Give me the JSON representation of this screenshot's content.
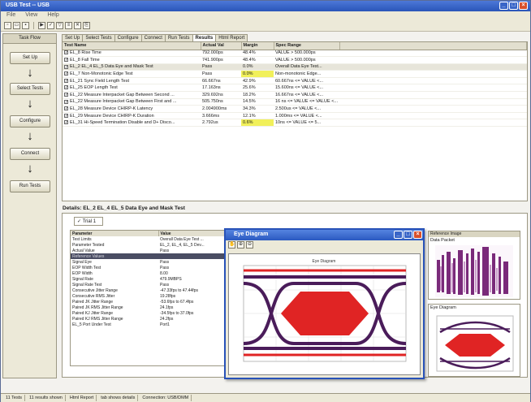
{
  "window": {
    "title": "USB Test -- USB",
    "minimize": "_",
    "maximize": "□",
    "close": "×"
  },
  "menu": [
    "File",
    "View",
    "Help"
  ],
  "taskflow": {
    "header": "Task Flow",
    "steps": [
      "Set Up",
      "Select Tests",
      "Configure",
      "Connect",
      "Run Tests"
    ]
  },
  "tabs": [
    "Set Up",
    "Select Tests",
    "Configure",
    "Connect",
    "Run Tests",
    "Results",
    "Html Report"
  ],
  "results": {
    "columns": [
      "Test Name",
      "Actual Val",
      "Margin",
      "Spec Range"
    ],
    "rows": [
      {
        "name": "EL_8 Rise Time",
        "actual": "792.000ps",
        "margin": "48.4%",
        "spec": "VALUE > 500.000ps",
        "hl": false
      },
      {
        "name": "EL_8 Fall Time",
        "actual": "741.900ps",
        "margin": "48.4%",
        "spec": "VALUE > 500.000ps",
        "hl": false
      },
      {
        "name": "EL_2 EL_4 EL_5 Data Eye and Mask Test",
        "actual": "Pass",
        "margin": "0.0%",
        "spec": "Overall Data Eye Test...",
        "hl": false,
        "sel": true
      },
      {
        "name": "EL_7 Non-Monotonic Edge Test",
        "actual": "Pass",
        "margin": "0.0%",
        "spec": "Non-monotonic Edge...",
        "hl": true
      },
      {
        "name": "EL_21 Sync Field Length Test",
        "actual": "66.667ns",
        "margin": "42.9%",
        "spec": "60.667ns <= VALUE <...",
        "hl": false
      },
      {
        "name": "EL_25 EOP Length Test",
        "actual": "17.163ns",
        "margin": "25.6%",
        "spec": "15.600ns <= VALUE <...",
        "hl": false
      },
      {
        "name": "EL_22 Measure Interpacket Gap Between Second ...",
        "actual": "329.692ns",
        "margin": "18.2%",
        "spec": "16.667ns <= VALUE <...",
        "hl": false
      },
      {
        "name": "EL_22 Measure Interpacket Gap Between First and ...",
        "actual": "505.750ns",
        "margin": "14.5%",
        "spec": "16 ns <= VALUE <= VALUE <...",
        "hl": false
      },
      {
        "name": "EL_28 Measure Device CHIRP-K Latency",
        "actual": "2.004900ms",
        "margin": "34.3%",
        "spec": "2.500us <= VALUE <...",
        "hl": false
      },
      {
        "name": "EL_29 Measure Device CHIRP-K Duration",
        "actual": "3.666ms",
        "margin": "12.1%",
        "spec": "1.000ms <= VALUE <...",
        "hl": false
      },
      {
        "name": "EL_31 Hi-Speed Termination Disable and D+ Disco...",
        "actual": "2.792us",
        "margin": "0.6%",
        "spec": "10ns <= VALUE <= 5...",
        "hl": true
      }
    ]
  },
  "details": {
    "title": "Details: EL_2 EL_4 EL_5 Data Eye and Mask Test",
    "trial_tab": "Trial 1",
    "columns": [
      "Parameter",
      "Value"
    ],
    "rows": [
      {
        "p": "Test Limits",
        "v": "Overall Data Eye Test ..."
      },
      {
        "p": "Parameter Tested",
        "v": "EL_2, EL_4, EL_5 Dev..."
      },
      {
        "p": "Actual Value",
        "v": "Pass"
      },
      {
        "p": "Reference Values",
        "v": "",
        "group": true
      },
      {
        "p": "Signal Eye",
        "v": "Pass"
      },
      {
        "p": "EOP Width Test",
        "v": "Pass"
      },
      {
        "p": "EOP Width",
        "v": "8.00"
      },
      {
        "p": "Signal Rate",
        "v": "479.9MBPS"
      },
      {
        "p": "Signal Rate Test",
        "v": "Pass"
      },
      {
        "p": "Consecutive Jitter Range",
        "v": "-47.33fps to 47.44fps"
      },
      {
        "p": "Consecutive RMS Jitter",
        "v": "19.28fps"
      },
      {
        "p": "Paired JK Jitter Range",
        "v": "-53.6fps to 67.4fps"
      },
      {
        "p": "Paired JK RMS Jitter Range",
        "v": "24.1fps"
      },
      {
        "p": "Paired KJ Jitter Range",
        "v": "-34.5fps to 37.0fps"
      },
      {
        "p": "Paired KJ RMS Jitter Range",
        "v": "24.2fps"
      },
      {
        "p": "EL_5 Port Under Test",
        "v": "Port1"
      }
    ]
  },
  "eye_dialog": {
    "title": "Eye Diagram",
    "plot_title": "Eye Diagram"
  },
  "right_panels": {
    "top_title": "Reference Image",
    "top_label": "Data Packet",
    "bottom_label": "Eye Diagram"
  },
  "status": [
    "11 Tests",
    "11 results shown",
    "Html Report",
    "tab shows details",
    "Connection: USB/DMM"
  ]
}
